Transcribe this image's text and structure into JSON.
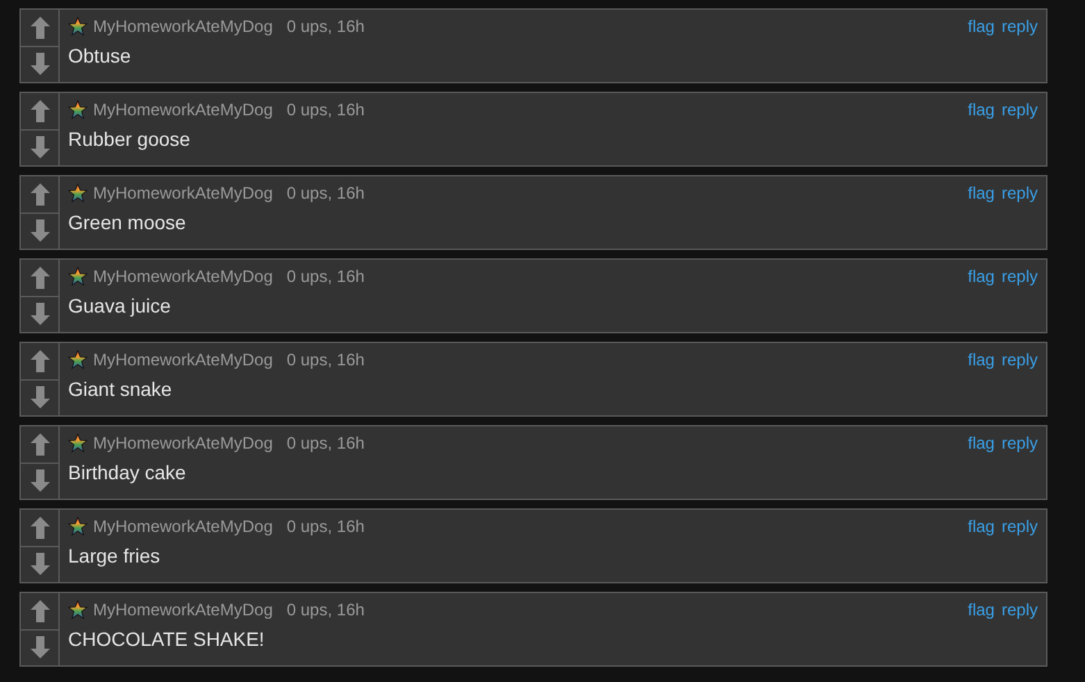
{
  "comments": [
    {
      "author": "MyHomeworkAteMyDog",
      "meta": "0 ups, 16h",
      "text": "Obtuse",
      "actions": [
        "flag",
        "reply"
      ]
    },
    {
      "author": "MyHomeworkAteMyDog",
      "meta": "0 ups, 16h",
      "text": "Rubber goose",
      "actions": [
        "flag",
        "reply"
      ]
    },
    {
      "author": "MyHomeworkAteMyDog",
      "meta": "0 ups, 16h",
      "text": "Green moose",
      "actions": [
        "flag",
        "reply"
      ]
    },
    {
      "author": "MyHomeworkAteMyDog",
      "meta": "0 ups, 16h",
      "text": "Guava juice",
      "actions": [
        "flag",
        "reply"
      ]
    },
    {
      "author": "MyHomeworkAteMyDog",
      "meta": "0 ups, 16h",
      "text": "Giant snake",
      "actions": [
        "flag",
        "reply"
      ]
    },
    {
      "author": "MyHomeworkAteMyDog",
      "meta": "0 ups, 16h",
      "text": "Birthday cake",
      "actions": [
        "flag",
        "reply"
      ]
    },
    {
      "author": "MyHomeworkAteMyDog",
      "meta": "0 ups, 16h",
      "text": "Large fries",
      "actions": [
        "flag",
        "reply"
      ]
    },
    {
      "author": "MyHomeworkAteMyDog",
      "meta": "0 ups, 16h",
      "text": "CHOCOLATE SHAKE!",
      "actions": [
        "flag",
        "reply"
      ]
    }
  ]
}
